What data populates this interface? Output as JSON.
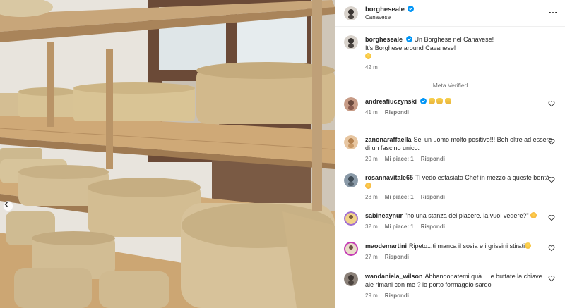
{
  "post": {
    "username": "borgheseale",
    "location": "Canavese",
    "caption_line1": "Un Borghese nel Canavese!",
    "caption_line2": "It's Borghese around Cavanese!",
    "caption_time": "42 m",
    "meta_verified": "Meta Verified"
  },
  "labels": {
    "reply": "Rispondi"
  },
  "comments": [
    {
      "user": "andreafiuczynski",
      "text": "",
      "time": "41 m",
      "likes": "",
      "verified": true,
      "emoji": "hands"
    },
    {
      "user": "zanonaraffaella",
      "text": "Sei un uomo molto positivo!!! Beh oltre ad essere di un fascino unico.",
      "time": "20 m",
      "likes": "Mi piace: 1"
    },
    {
      "user": "rosannavitale65",
      "text": "Ti vedo estasiato Chef in mezzo a queste bontà",
      "time": "28 m",
      "likes": "Mi piace: 1"
    },
    {
      "user": "sabineaynur",
      "text": "\"ho una stanza del piacere. la vuoi vedere?\"",
      "time": "32 m",
      "likes": "Mi piace: 1"
    },
    {
      "user": "maodemartini",
      "text": "Ripeto...ti manca il sosia e i grissini stirati",
      "time": "27 m",
      "likes": ""
    },
    {
      "user": "wandaniela_wilson",
      "text": "Abbandonatemi quà ... e buttate la chiave ... ale rimani con me ? lo porto formaggio sardo",
      "time": "29 m",
      "likes": ""
    }
  ],
  "colors": {
    "verified": "#0095f6",
    "secondary_text": "#737373",
    "text": "#262626"
  }
}
